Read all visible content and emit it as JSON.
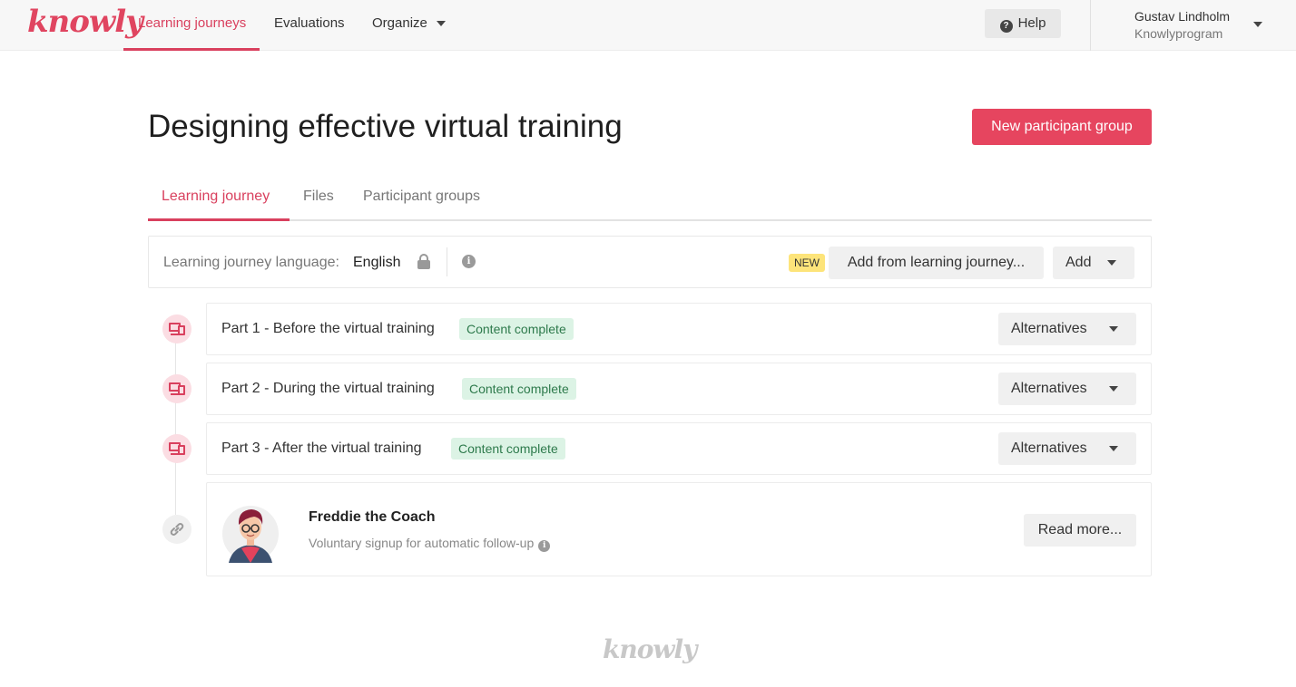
{
  "brand": {
    "logo_text": "knowly",
    "accent_color": "#e6455f"
  },
  "nav": {
    "items": [
      {
        "label": "Learning journeys",
        "active": true
      },
      {
        "label": "Evaluations",
        "active": false
      },
      {
        "label": "Organize",
        "active": false
      }
    ],
    "help_label": "Help",
    "user": {
      "name": "Gustav Lindholm",
      "org": "Knowlyprogram"
    }
  },
  "page": {
    "title": "Designing effective virtual training",
    "primary_action": "New participant group"
  },
  "tabs": [
    {
      "label": "Learning journey",
      "active": true
    },
    {
      "label": "Files",
      "active": false
    },
    {
      "label": "Participant groups",
      "active": false
    }
  ],
  "language_bar": {
    "label": "Learning journey language:",
    "value": "English",
    "new_badge": "NEW",
    "add_from_label": "Add from learning journey...",
    "add_label": "Add"
  },
  "journey_parts": [
    {
      "title": "Part 1 - Before the virtual training",
      "status": "Content complete",
      "action": "Alternatives"
    },
    {
      "title": "Part 2 - During the virtual training",
      "status": "Content complete",
      "action": "Alternatives"
    },
    {
      "title": "Part 3 - After the virtual training",
      "status": "Content complete",
      "action": "Alternatives"
    }
  ],
  "coach": {
    "name": "Freddie the Coach",
    "description": "Voluntary signup for automatic follow-up",
    "action": "Read more..."
  },
  "footer": {
    "logo_text": "knowly"
  }
}
